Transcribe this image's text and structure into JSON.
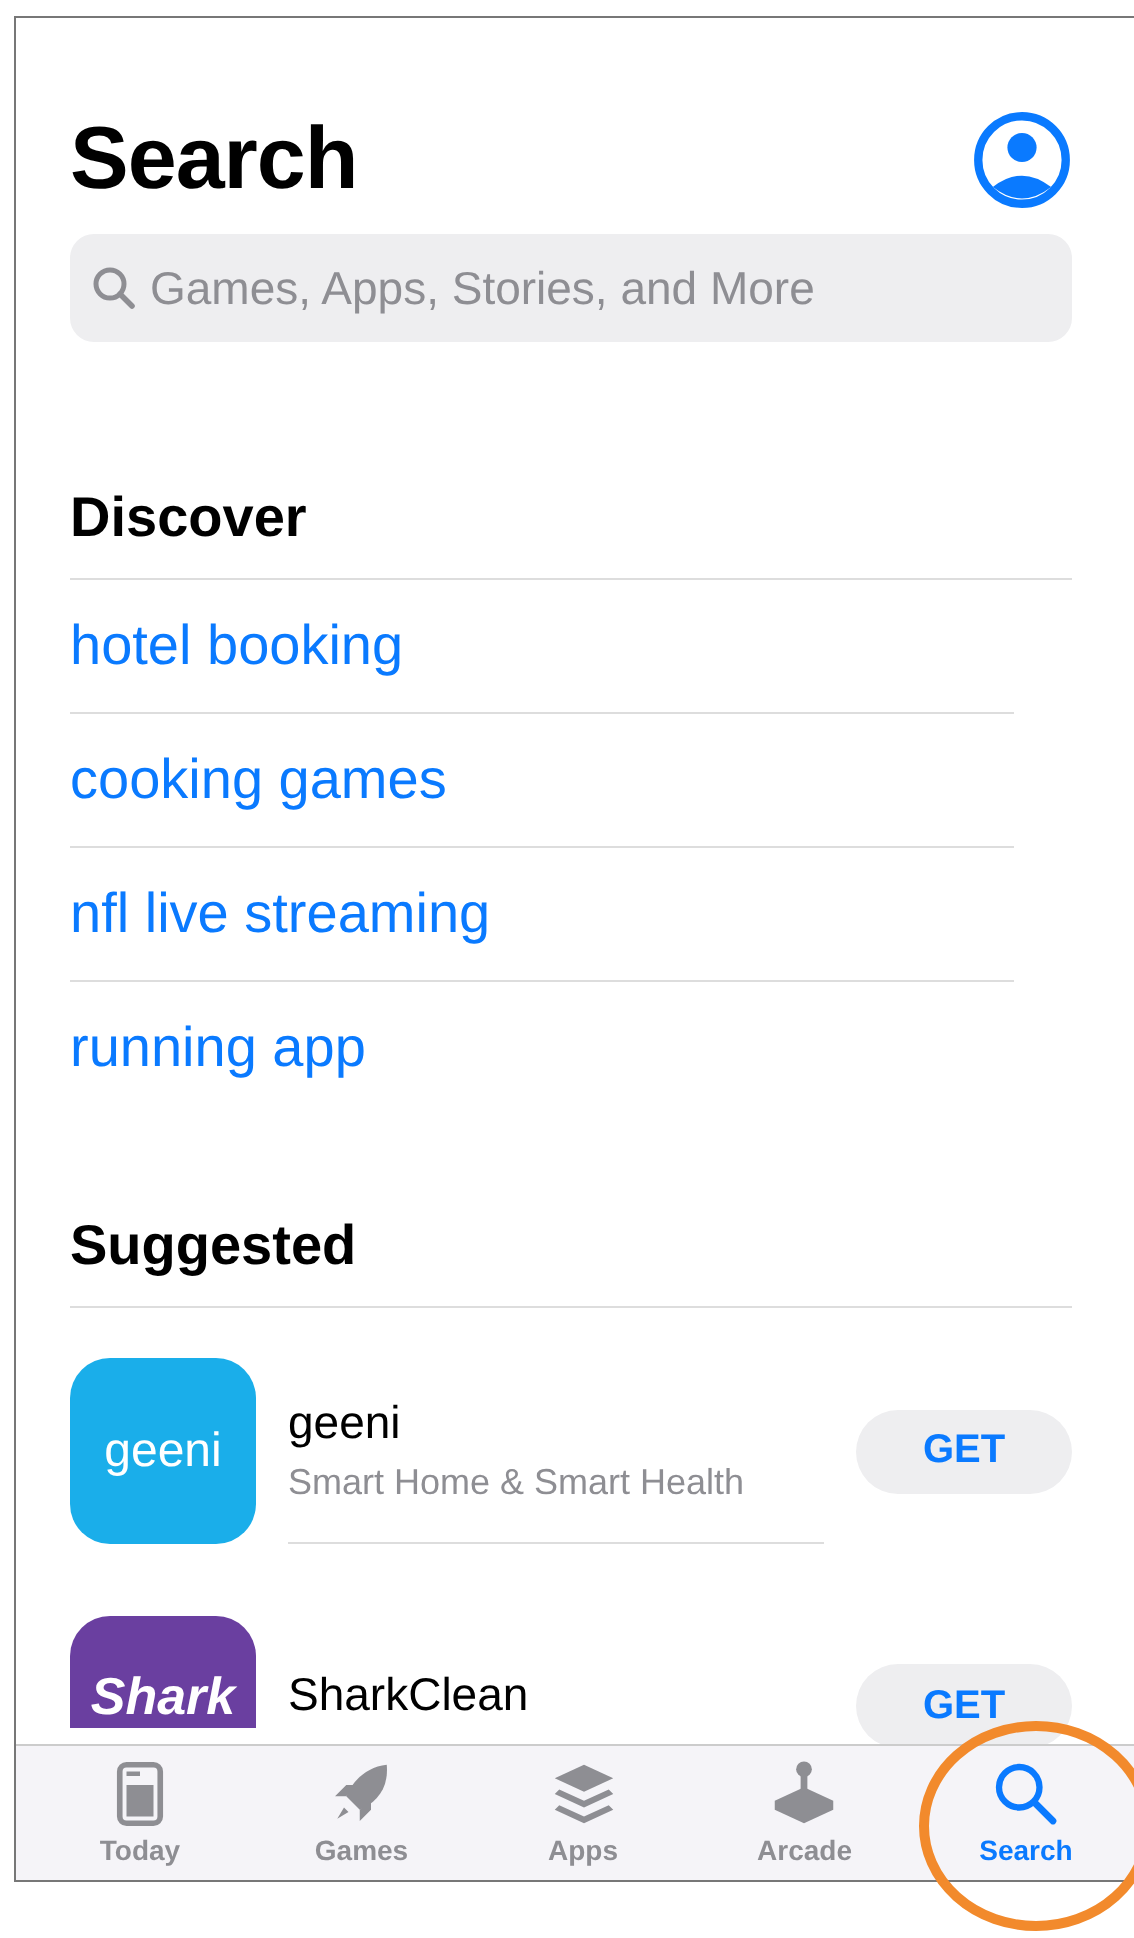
{
  "header": {
    "title": "Search"
  },
  "search": {
    "placeholder": "Games, Apps, Stories, and More"
  },
  "discover": {
    "heading": "Discover",
    "items": [
      {
        "label": "hotel booking"
      },
      {
        "label": "cooking games"
      },
      {
        "label": "nfl live streaming"
      },
      {
        "label": "running app"
      }
    ]
  },
  "suggested": {
    "heading": "Suggested",
    "apps": [
      {
        "name": "geeni",
        "subtitle": "Smart Home & Smart Health",
        "icon_text": "geeni",
        "color": "#1aaeea",
        "button": "GET"
      },
      {
        "name": "SharkClean",
        "icon_text": "Shark",
        "color": "#6a3fa0",
        "button": "GET"
      }
    ]
  },
  "tab_bar": [
    {
      "label": "Today",
      "kind": "today",
      "selected": false
    },
    {
      "label": "Games",
      "kind": "games",
      "selected": false
    },
    {
      "label": "Apps",
      "kind": "apps",
      "selected": false
    },
    {
      "label": "Arcade",
      "kind": "arcade",
      "selected": false
    },
    {
      "label": "Search",
      "kind": "search",
      "selected": true
    }
  ]
}
